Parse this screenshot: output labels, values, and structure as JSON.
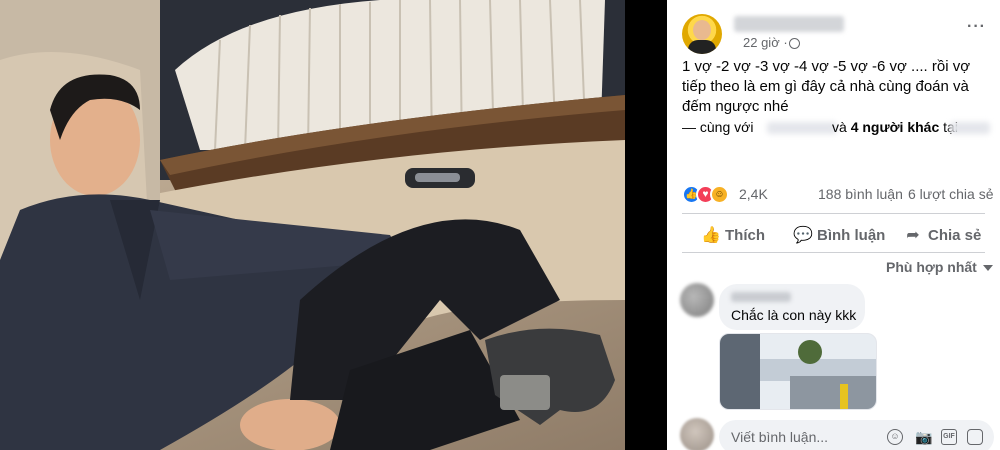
{
  "post": {
    "author": "",
    "time": "22 giờ ·",
    "caption": "1 vợ -2 vợ -3 vợ -4 vợ -5 vợ -6 vợ .... rồi vợ tiếp theo là em gì đây cả nhà cùng đoán và đếm ngược nhé",
    "with_label": "— cùng với",
    "others_prefix": "và",
    "others_count": "4 người khác",
    "at_label": "tại"
  },
  "stats": {
    "reactions": "2,4K",
    "comments": "188 bình luận",
    "shares": "6 lượt chia sẻ"
  },
  "actions": {
    "like": "Thích",
    "comment": "Bình luận",
    "share": "Chia sẻ"
  },
  "comments": {
    "sort_label": "Phù hợp nhất",
    "items": [
      {
        "author": "",
        "text": "Chắc là con này kkk"
      }
    ]
  },
  "composer": {
    "placeholder": "Viết bình luận..."
  },
  "colors": {
    "accent": "#1877f2",
    "text": "#050505",
    "secondary": "#65676b",
    "bubble": "#f0f2f5"
  },
  "icons": {
    "more": "more-horizontal-icon",
    "audience": "globe-icon",
    "like": "thumbs-up-icon",
    "comment": "speech-bubble-icon",
    "share": "share-arrow-icon"
  }
}
